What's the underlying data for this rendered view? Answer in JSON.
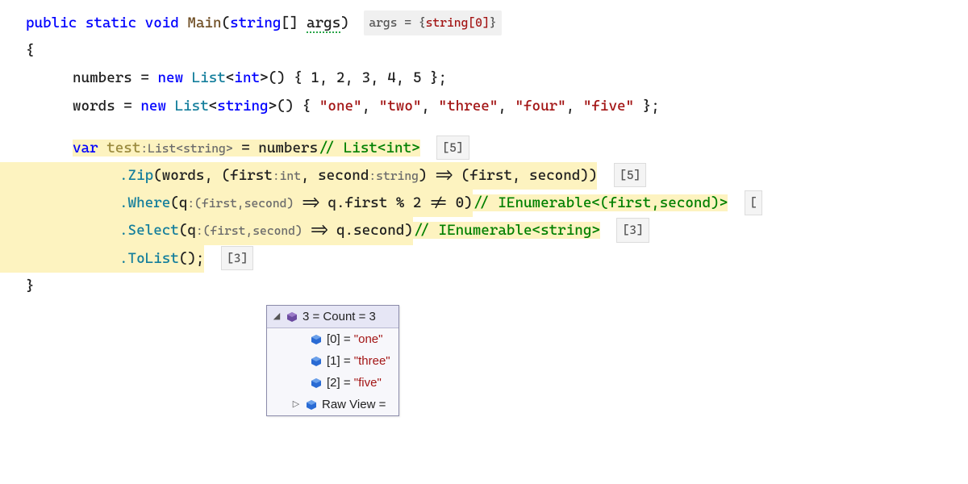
{
  "sig": {
    "public": "public",
    "static": "static",
    "void": "void",
    "Main": "Main",
    "string": "string",
    "args": "args",
    "hint_label": "args = {",
    "hint_val": "string[0]",
    "hint_close": "}"
  },
  "l_numbers": {
    "name": "numbers",
    "new": "new",
    "List": "List",
    "int": "int",
    "vals": "1, 2, 3, 4, 5"
  },
  "l_words": {
    "name": "words",
    "new": "new",
    "List": "List",
    "string": "string",
    "v1": "\"one\"",
    "v2": "\"two\"",
    "v3": "\"three\"",
    "v4": "\"four\"",
    "v5": "\"five\""
  },
  "linq": {
    "var": "var",
    "test": "test",
    "test_hint": ":List<string>",
    "numbers": "numbers",
    "numbers_comment": "// List<int>",
    "numbers_count": "[5]",
    "zip": ".Zip",
    "zip_words": "words",
    "zip_first": "first",
    "zip_first_hint": ":int",
    "zip_second": "second",
    "zip_second_hint": ":string",
    "zip_arrow": " => (first, second))",
    "zip_count": "[5]",
    "where": ".Where",
    "where_q": "q",
    "where_q_hint": ":(first,second)",
    "where_body": " => q.first % 2 != 0)",
    "where_comment": "// IEnumerable<(first,second)>",
    "where_count": "[",
    "select": ".Select",
    "select_q": "q",
    "select_q_hint": ":(first,second)",
    "select_body": " => q.second)",
    "select_comment": "// IEnumerable<string>",
    "select_count": "[3]",
    "tolist": ".ToList",
    "tolist_paren": "();",
    "tolist_count": "[3]"
  },
  "popup": {
    "header": "3 = Count = 3",
    "rows": [
      {
        "idx": "[0] = ",
        "val": "\"one\""
      },
      {
        "idx": "[1] = ",
        "val": "\"three\""
      },
      {
        "idx": "[2] = ",
        "val": "\"five\""
      }
    ],
    "raw": "Raw View ="
  },
  "braces": {
    "open": "{",
    "close": "}"
  }
}
